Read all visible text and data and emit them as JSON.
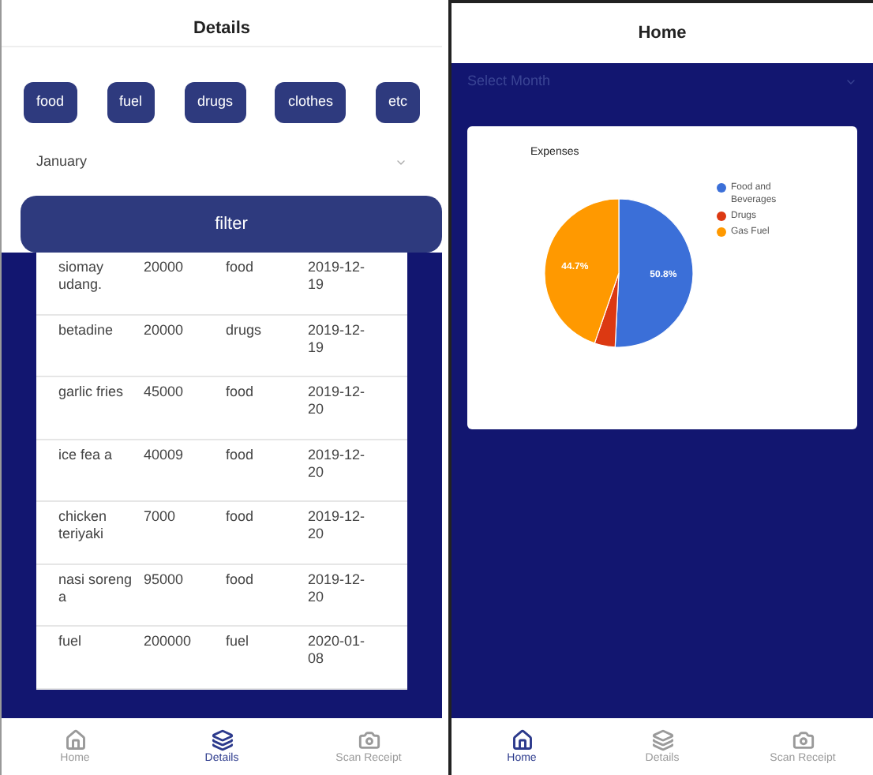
{
  "details": {
    "title": "Details",
    "categories": [
      "food",
      "fuel",
      "drugs",
      "clothes",
      "etc"
    ],
    "month": {
      "value": "January"
    },
    "filter_button": "filter",
    "rows": [
      {
        "name": "siomay udang.",
        "amount": "20000",
        "category": "food",
        "date": "2019-12-19"
      },
      {
        "name": "betadine",
        "amount": "20000",
        "category": "drugs",
        "date": "2019-12-19"
      },
      {
        "name": "garlic fries",
        "amount": "45000",
        "category": "food",
        "date": "2019-12-20"
      },
      {
        "name": "ice fea a",
        "amount": "40009",
        "category": "food",
        "date": "2019-12-20"
      },
      {
        "name": "chicken teriyaki",
        "amount": "7000",
        "category": "food",
        "date": "2019-12-20"
      },
      {
        "name": "nasi soreng a",
        "amount": "95000",
        "category": "food",
        "date": "2019-12-20"
      },
      {
        "name": "fuel",
        "amount": "200000",
        "category": "fuel",
        "date": "2020-01-08"
      }
    ],
    "nav": [
      {
        "label": "Home",
        "selected": false
      },
      {
        "label": "Details",
        "selected": true
      },
      {
        "label": "Scan Receipt",
        "selected": false
      }
    ]
  },
  "home": {
    "title": "Home",
    "month_select": {
      "placeholder": "Select Month"
    },
    "chart_data": {
      "type": "pie",
      "title": "Expenses",
      "categories": [
        "Food and Beverages",
        "Drugs",
        "Gas Fuel"
      ],
      "legend": "right",
      "series": [
        {
          "colors": [
            "#3b6fd8",
            "#dc3912",
            "#ff9900"
          ],
          "values": [
            50.8,
            4.5,
            44.7
          ]
        }
      ],
      "value_labels": [
        "50.8%",
        null,
        "44.7%"
      ]
    },
    "nav": [
      {
        "label": "Home",
        "selected": true
      },
      {
        "label": "Details",
        "selected": false
      },
      {
        "label": "Scan Receipt",
        "selected": false
      }
    ]
  }
}
